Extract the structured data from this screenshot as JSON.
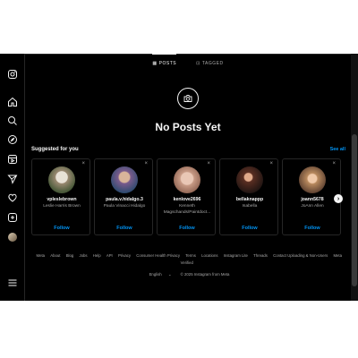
{
  "tabs": [
    {
      "label": "POSTS",
      "glyph": "▦",
      "active": true
    },
    {
      "label": "TAGGED",
      "glyph": "⊡",
      "active": false
    }
  ],
  "empty_state": {
    "title": "No Posts Yet",
    "icon": "camera-icon"
  },
  "suggested": {
    "heading": "Suggested for you",
    "see_all": "See all",
    "cards": [
      {
        "username": "vpleslebrown",
        "full_name": "Leslie Harris Brown",
        "follow": "Follow",
        "close": "×"
      },
      {
        "username": "paula.v.hidalgo.3",
        "full_name": "Paula Vinacci Hidalgo",
        "follow": "Follow",
        "close": "×"
      },
      {
        "username": "kenlove2696",
        "full_name": "Kenneth Magschands/Paintdoct...",
        "follow": "Follow",
        "close": "×"
      },
      {
        "username": "bellaknappp",
        "full_name": "Isabella",
        "follow": "Follow",
        "close": "×"
      },
      {
        "username": "joann5678",
        "full_name": "JoAnn Allen",
        "follow": "Follow",
        "close": "×"
      }
    ],
    "next_glyph": "›"
  },
  "footer": {
    "links": [
      "Meta",
      "About",
      "Blog",
      "Jobs",
      "Help",
      "API",
      "Privacy",
      "Consumer Health Privacy",
      "Terms",
      "Locations",
      "Instagram Lite",
      "Threads",
      "Contact Uploading & Non-Users",
      "Meta Verified"
    ],
    "language": "English",
    "language_chevron": "⌄",
    "copyright": "© 2025 Instagram from Meta"
  },
  "sidebar_icons": [
    "instagram-icon",
    "home-icon",
    "search-icon",
    "explore-icon",
    "reels-icon",
    "messages-icon",
    "notifications-icon",
    "create-icon",
    "profile-avatar",
    "menu-icon"
  ],
  "colors": {
    "background": "#000000",
    "link_blue": "#0095f6",
    "muted": "#a8a8a8"
  }
}
